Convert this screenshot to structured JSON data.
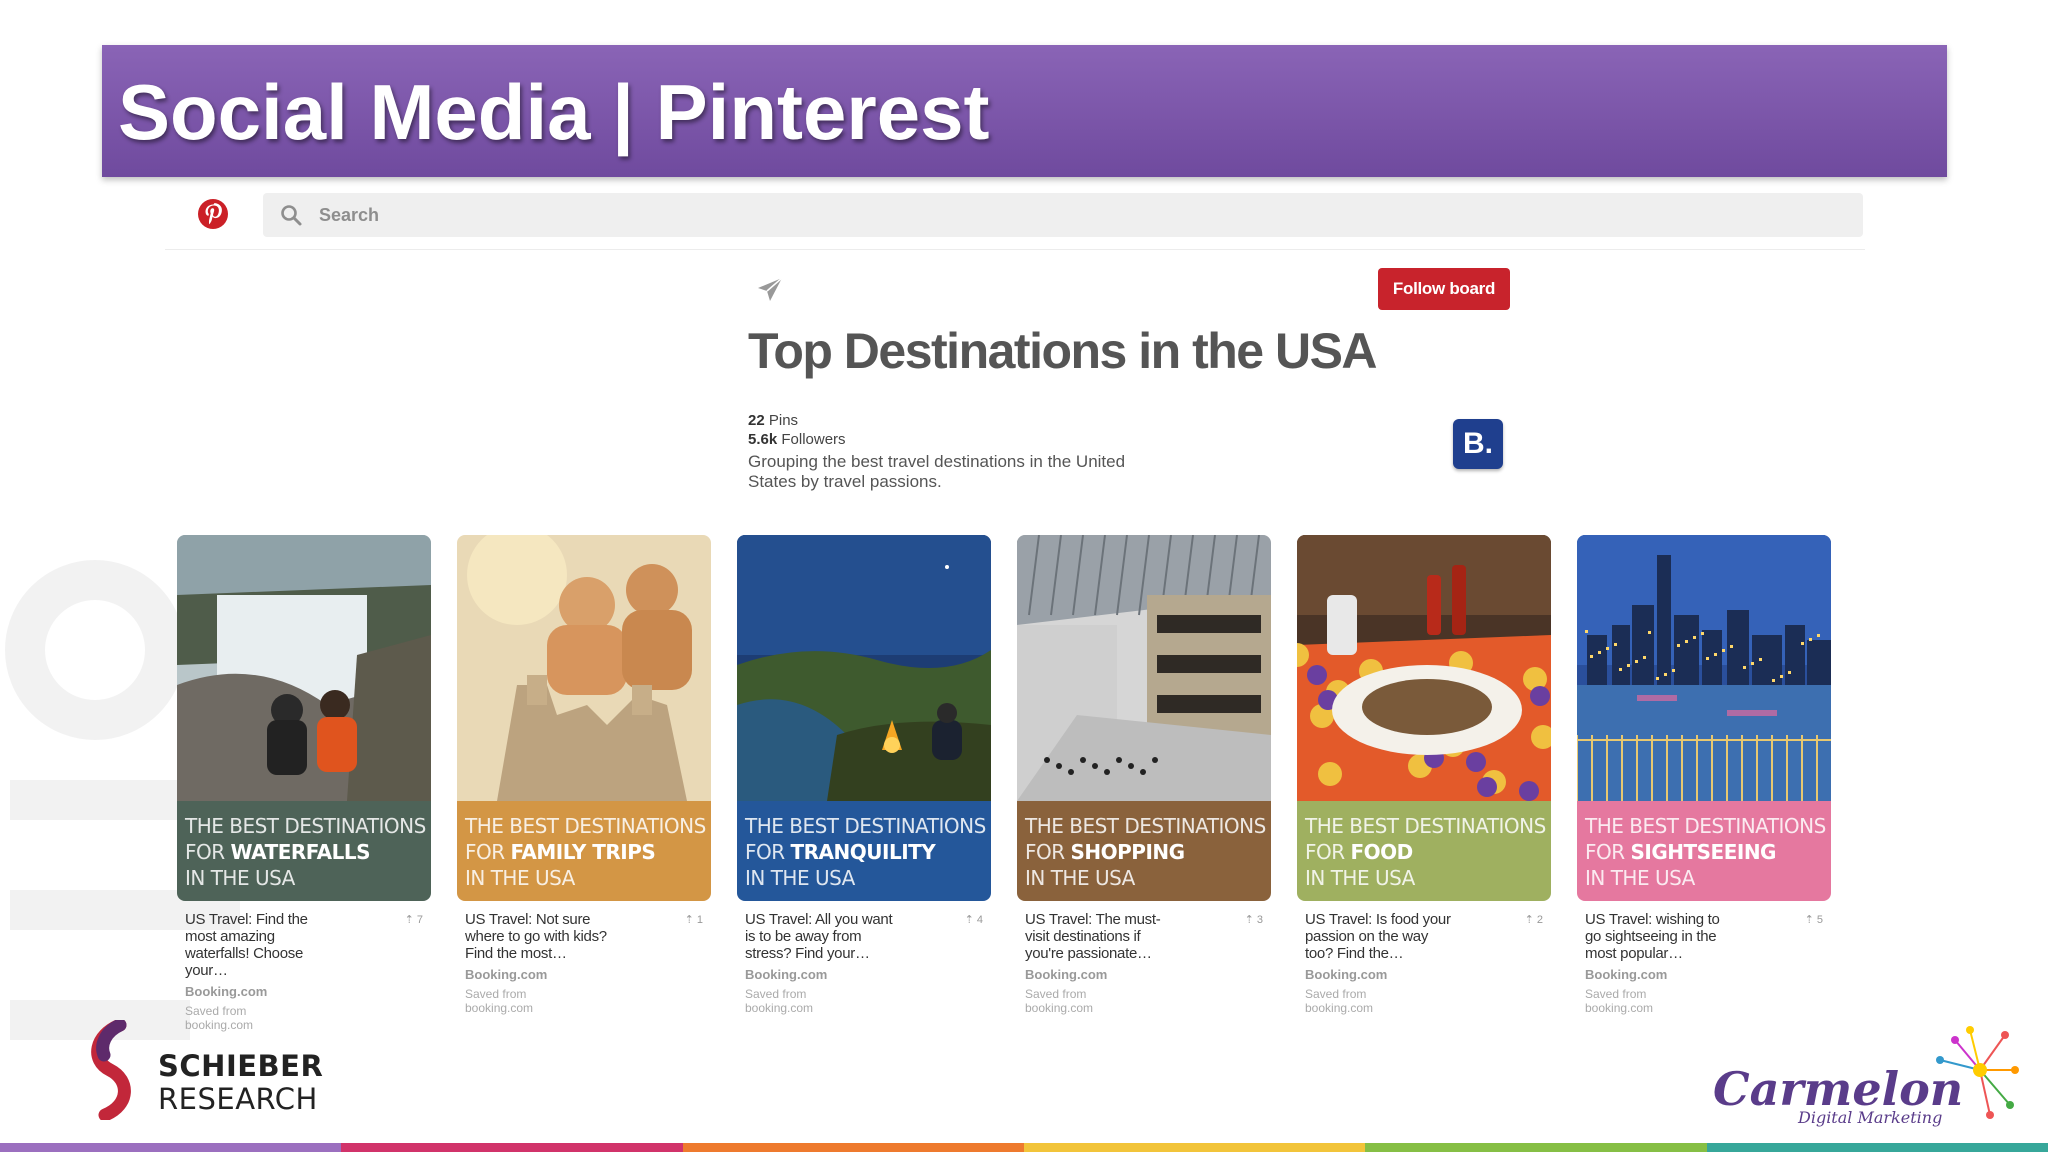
{
  "slide": {
    "title": "Social Media | Pinterest"
  },
  "pinterest": {
    "search_placeholder": "Search",
    "follow_label": "Follow board",
    "board_title": "Top Destinations in the USA",
    "pins_count": "22",
    "pins_label": " Pins",
    "followers_count": "5.6k",
    "followers_label": " Followers",
    "description": "Grouping the best travel destinations in the United States by travel passions.",
    "badge_letter": "B."
  },
  "pins": [
    {
      "line1": "THE BEST DESTINATIONS",
      "line2_prefix": "FOR ",
      "line2_bold": "WATERFALLS",
      "line3": "IN THE USA",
      "desc": "US Travel: Find the most amazing waterfalls! Choose your…",
      "count": "7",
      "source": "Booking.com",
      "saved": "Saved from booking.com",
      "color": "#4e6358",
      "icon": "waterfall-scene"
    },
    {
      "line1": "THE BEST DESTINATIONS",
      "line2_prefix": "FOR ",
      "line2_bold": "FAMILY TRIPS",
      "line3": "IN THE USA",
      "desc": "US Travel: Not sure where to go with kids? Find the most…",
      "count": "1",
      "source": "Booking.com",
      "saved": "Saved from booking.com",
      "color": "#d39645",
      "icon": "sandcastle-scene"
    },
    {
      "line1": "THE BEST DESTINATIONS",
      "line2_prefix": "FOR ",
      "line2_bold": "TRANQUILITY",
      "line3": "IN THE USA",
      "desc": "US Travel: All you want is to be away from stress? Find your…",
      "count": "4",
      "source": "Booking.com",
      "saved": "Saved from booking.com",
      "color": "#24579a",
      "icon": "campfire-scene"
    },
    {
      "line1": "THE BEST DESTINATIONS",
      "line2_prefix": "FOR ",
      "line2_bold": "SHOPPING",
      "line3": "IN THE USA",
      "desc": "US Travel: The must-visit destinations if you're passionate…",
      "count": "3",
      "source": "Booking.com",
      "saved": "Saved from booking.com",
      "color": "#8a623c",
      "icon": "mall-scene"
    },
    {
      "line1": "THE BEST DESTINATIONS",
      "line2_prefix": "FOR ",
      "line2_bold": "FOOD",
      "line3": "IN THE USA",
      "desc": "US Travel: Is food your passion on the way too? Find the…",
      "count": "2",
      "source": "Booking.com",
      "saved": "Saved from booking.com",
      "color": "#9fb060",
      "icon": "soup-scene"
    },
    {
      "line1": "THE BEST DESTINATIONS",
      "line2_prefix": "FOR ",
      "line2_bold": "SIGHTSEEING",
      "line3": "IN THE USA",
      "desc": "US Travel: wishing to go sightseeing in the most popular…",
      "count": "5",
      "source": "Booking.com",
      "saved": "Saved from booking.com",
      "color": "#e5789f",
      "icon": "skyline-scene"
    }
  ],
  "footer": {
    "schieber_line1": "SCHIEBER",
    "schieber_line2": "RESEARCH",
    "carmelon_name": "Carmelon",
    "carmelon_tagline": "Digital Marketing",
    "strip_colors": [
      "#9b6fbf",
      "#d1336a",
      "#ee7a2e",
      "#f2c43a",
      "#86bf45",
      "#37a79a"
    ]
  }
}
